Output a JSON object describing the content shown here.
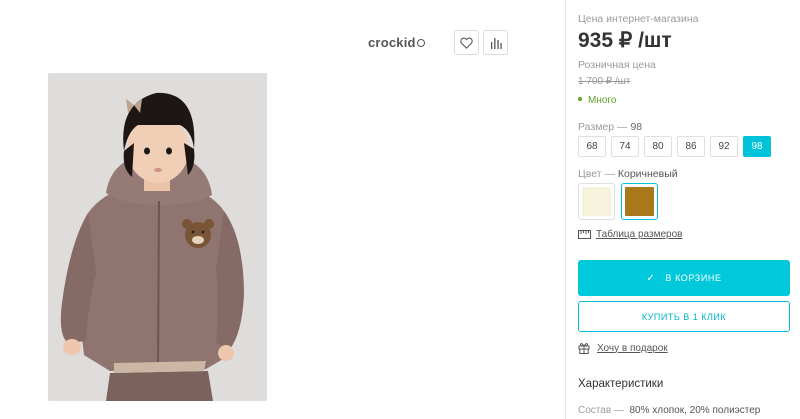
{
  "product": {
    "brand": "crockid",
    "image_alt": "child in brown hoodie with bear patch"
  },
  "actions": {
    "favorite_icon": "heart-icon",
    "compare_icon": "bar-chart-icon"
  },
  "pricing": {
    "online_price_label": "Цена интернет-магазина",
    "online_price": "935 ₽ /шт",
    "retail_label": "Розничная цена",
    "retail_price": "1 700 ₽ /шт",
    "stock_status": "Много",
    "stock_color": "#5fa32c"
  },
  "size": {
    "label": "Размер",
    "separator": "—",
    "selected": "98",
    "options": [
      "68",
      "74",
      "80",
      "86",
      "92",
      "98"
    ],
    "accent_color": "#00c3d9"
  },
  "color": {
    "label": "Цвет",
    "separator": "—",
    "selected": "Коричневый",
    "swatches": [
      {
        "name": "cream",
        "hex": "#f6f3dd"
      },
      {
        "name": "brown",
        "hex": "#a9781a"
      }
    ]
  },
  "links": {
    "size_table": "Таблица размеров",
    "gift": "Хочу в подарок"
  },
  "buttons": {
    "in_cart": "В КОРЗИНЕ",
    "buy_one_click": "КУПИТЬ В 1 КЛИК"
  },
  "characteristics": {
    "heading": "Характеристики",
    "composition_key": "Состав",
    "composition_sep": "—",
    "composition_value": "80% хлопок, 20% полиэстер"
  }
}
